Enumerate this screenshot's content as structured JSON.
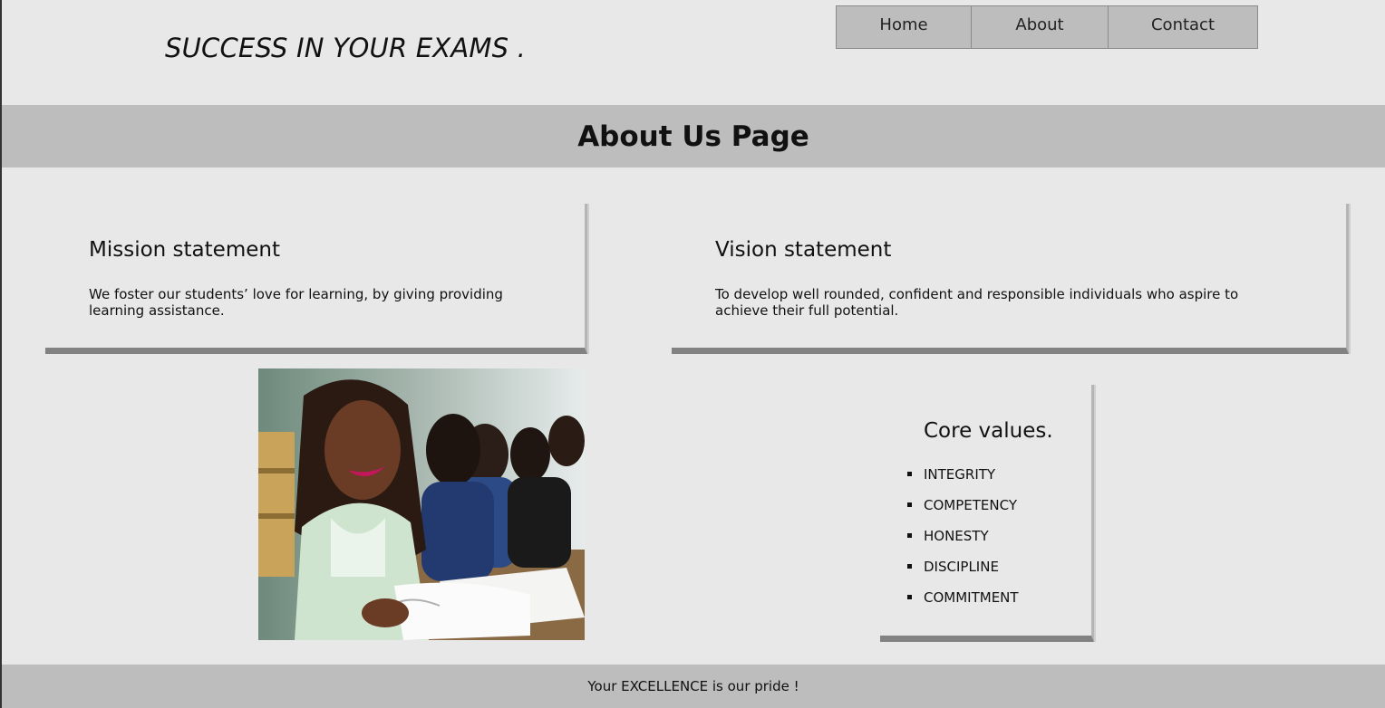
{
  "header": {
    "brand": "SUCCESS IN YOUR EXAMS .",
    "nav": [
      "Home",
      "About",
      "Contact"
    ]
  },
  "banner": {
    "title": "About Us Page"
  },
  "mission": {
    "title": "Mission statement",
    "text": "We foster our students’ love for learning, by giving providing learning assistance."
  },
  "vision": {
    "title": "Vision statement",
    "text": "To develop well rounded, confident and responsible individuals who aspire to achieve their full potential."
  },
  "core_values": {
    "title": "Core values.",
    "items": [
      "INTEGRITY",
      "COMPETENCY",
      "HONESTY",
      "DISCIPLINE",
      "COMMITMENT"
    ]
  },
  "footer": {
    "text": "Your EXCELLENCE is our pride !"
  },
  "colors": {
    "background": "#e8e8e8",
    "band": "#bdbdbd",
    "card_shadow": "#828282"
  }
}
